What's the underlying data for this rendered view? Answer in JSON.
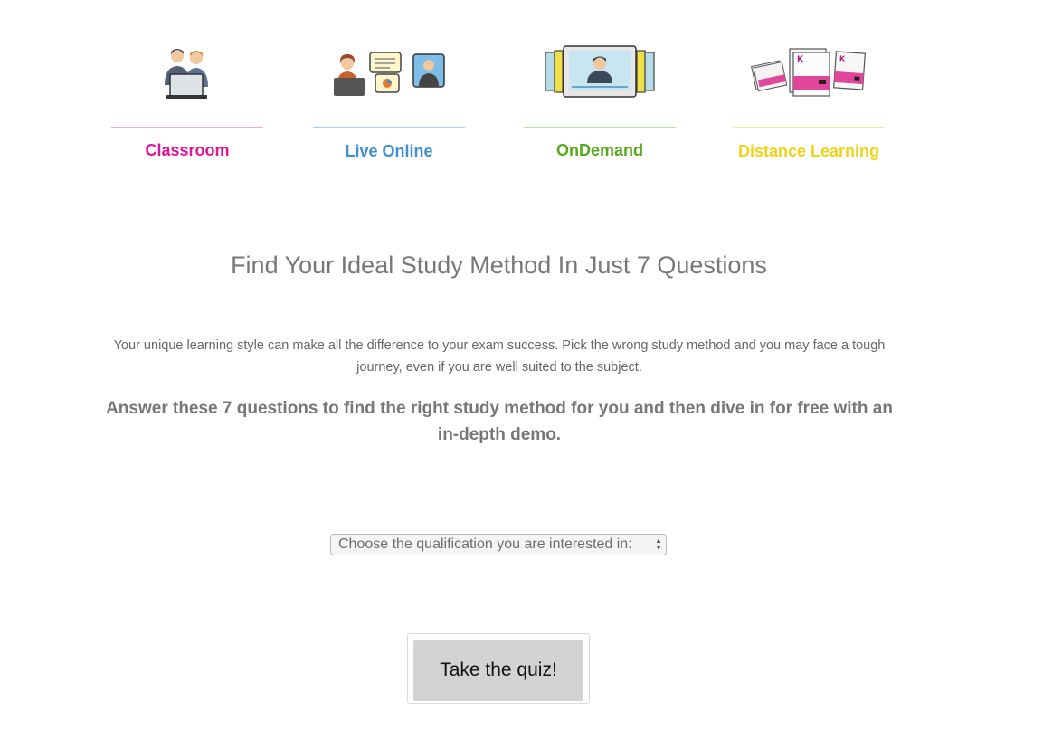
{
  "methods": [
    {
      "label": "Classroom",
      "color": "#e0149a",
      "rule_color": "#f2a9d6",
      "icon": "classroom-icon"
    },
    {
      "label": "Live Online",
      "color": "#3f8fd1",
      "rule_color": "#a9cdee",
      "icon": "live-online-icon"
    },
    {
      "label": "OnDemand",
      "color": "#58a81b",
      "rule_color": "#bfe1a2",
      "icon": "ondemand-icon"
    },
    {
      "label": "Distance Learning",
      "color": "#f0d21a",
      "rule_color": "#f7e99a",
      "icon": "distance-learning-icon"
    }
  ],
  "page": {
    "title": "Find Your Ideal Study Method In Just 7 Questions",
    "intro": "Your unique learning style can make all the difference to your exam success. Pick the wrong study method and you may face a tough journey, even if you are well suited to the subject.",
    "cta": "Answer these 7 questions to find the right study method for you and then dive in for free with an in-depth demo."
  },
  "form": {
    "qualification_select": "Choose the qualification you are interested in:",
    "submit_label": "Take the quiz!"
  }
}
